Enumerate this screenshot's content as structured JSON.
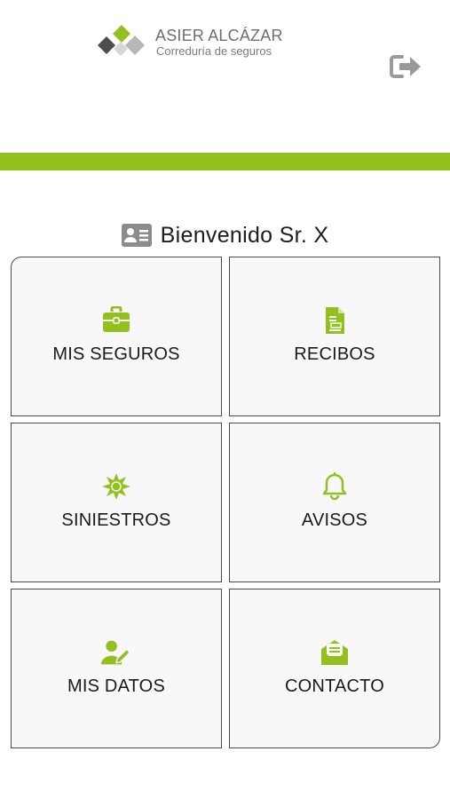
{
  "brand": {
    "name": "ASIER ALCÁZAR",
    "tagline": "Correduría de seguros",
    "colors": {
      "accent_green": "#93c01f",
      "logo_gray_dark": "#4d4d4d",
      "logo_gray_light": "#b3b3b3"
    }
  },
  "header": {
    "logout_icon": "sign-out-icon"
  },
  "welcome": {
    "icon": "id-card-icon",
    "text": "Bienvenido Sr. X"
  },
  "menu": {
    "tiles": [
      {
        "label": "MIS SEGUROS",
        "icon": "briefcase-icon"
      },
      {
        "label": "RECIBOS",
        "icon": "document-icon"
      },
      {
        "label": "SINIESTROS",
        "icon": "burst-icon"
      },
      {
        "label": "AVISOS",
        "icon": "bell-icon"
      },
      {
        "label": "MIS DATOS",
        "icon": "user-edit-icon"
      },
      {
        "label": "CONTACTO",
        "icon": "envelope-open-icon"
      }
    ]
  }
}
